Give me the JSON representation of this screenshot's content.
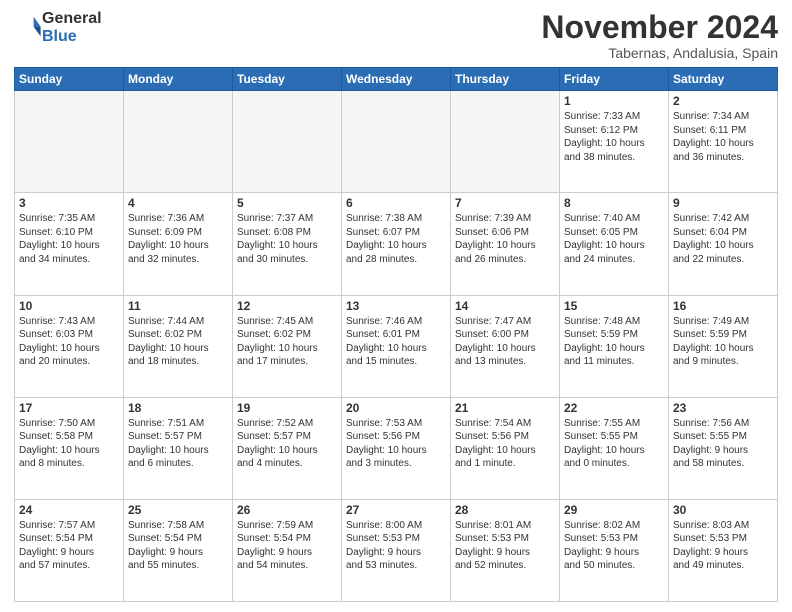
{
  "header": {
    "logo_line1": "General",
    "logo_line2": "Blue",
    "month": "November 2024",
    "location": "Tabernas, Andalusia, Spain"
  },
  "weekdays": [
    "Sunday",
    "Monday",
    "Tuesday",
    "Wednesday",
    "Thursday",
    "Friday",
    "Saturday"
  ],
  "weeks": [
    [
      {
        "day": "",
        "info": "",
        "empty": true
      },
      {
        "day": "",
        "info": "",
        "empty": true
      },
      {
        "day": "",
        "info": "",
        "empty": true
      },
      {
        "day": "",
        "info": "",
        "empty": true
      },
      {
        "day": "",
        "info": "",
        "empty": true
      },
      {
        "day": "1",
        "info": "Sunrise: 7:33 AM\nSunset: 6:12 PM\nDaylight: 10 hours\nand 38 minutes.",
        "empty": false
      },
      {
        "day": "2",
        "info": "Sunrise: 7:34 AM\nSunset: 6:11 PM\nDaylight: 10 hours\nand 36 minutes.",
        "empty": false
      }
    ],
    [
      {
        "day": "3",
        "info": "Sunrise: 7:35 AM\nSunset: 6:10 PM\nDaylight: 10 hours\nand 34 minutes.",
        "empty": false
      },
      {
        "day": "4",
        "info": "Sunrise: 7:36 AM\nSunset: 6:09 PM\nDaylight: 10 hours\nand 32 minutes.",
        "empty": false
      },
      {
        "day": "5",
        "info": "Sunrise: 7:37 AM\nSunset: 6:08 PM\nDaylight: 10 hours\nand 30 minutes.",
        "empty": false
      },
      {
        "day": "6",
        "info": "Sunrise: 7:38 AM\nSunset: 6:07 PM\nDaylight: 10 hours\nand 28 minutes.",
        "empty": false
      },
      {
        "day": "7",
        "info": "Sunrise: 7:39 AM\nSunset: 6:06 PM\nDaylight: 10 hours\nand 26 minutes.",
        "empty": false
      },
      {
        "day": "8",
        "info": "Sunrise: 7:40 AM\nSunset: 6:05 PM\nDaylight: 10 hours\nand 24 minutes.",
        "empty": false
      },
      {
        "day": "9",
        "info": "Sunrise: 7:42 AM\nSunset: 6:04 PM\nDaylight: 10 hours\nand 22 minutes.",
        "empty": false
      }
    ],
    [
      {
        "day": "10",
        "info": "Sunrise: 7:43 AM\nSunset: 6:03 PM\nDaylight: 10 hours\nand 20 minutes.",
        "empty": false
      },
      {
        "day": "11",
        "info": "Sunrise: 7:44 AM\nSunset: 6:02 PM\nDaylight: 10 hours\nand 18 minutes.",
        "empty": false
      },
      {
        "day": "12",
        "info": "Sunrise: 7:45 AM\nSunset: 6:02 PM\nDaylight: 10 hours\nand 17 minutes.",
        "empty": false
      },
      {
        "day": "13",
        "info": "Sunrise: 7:46 AM\nSunset: 6:01 PM\nDaylight: 10 hours\nand 15 minutes.",
        "empty": false
      },
      {
        "day": "14",
        "info": "Sunrise: 7:47 AM\nSunset: 6:00 PM\nDaylight: 10 hours\nand 13 minutes.",
        "empty": false
      },
      {
        "day": "15",
        "info": "Sunrise: 7:48 AM\nSunset: 5:59 PM\nDaylight: 10 hours\nand 11 minutes.",
        "empty": false
      },
      {
        "day": "16",
        "info": "Sunrise: 7:49 AM\nSunset: 5:59 PM\nDaylight: 10 hours\nand 9 minutes.",
        "empty": false
      }
    ],
    [
      {
        "day": "17",
        "info": "Sunrise: 7:50 AM\nSunset: 5:58 PM\nDaylight: 10 hours\nand 8 minutes.",
        "empty": false
      },
      {
        "day": "18",
        "info": "Sunrise: 7:51 AM\nSunset: 5:57 PM\nDaylight: 10 hours\nand 6 minutes.",
        "empty": false
      },
      {
        "day": "19",
        "info": "Sunrise: 7:52 AM\nSunset: 5:57 PM\nDaylight: 10 hours\nand 4 minutes.",
        "empty": false
      },
      {
        "day": "20",
        "info": "Sunrise: 7:53 AM\nSunset: 5:56 PM\nDaylight: 10 hours\nand 3 minutes.",
        "empty": false
      },
      {
        "day": "21",
        "info": "Sunrise: 7:54 AM\nSunset: 5:56 PM\nDaylight: 10 hours\nand 1 minute.",
        "empty": false
      },
      {
        "day": "22",
        "info": "Sunrise: 7:55 AM\nSunset: 5:55 PM\nDaylight: 10 hours\nand 0 minutes.",
        "empty": false
      },
      {
        "day": "23",
        "info": "Sunrise: 7:56 AM\nSunset: 5:55 PM\nDaylight: 9 hours\nand 58 minutes.",
        "empty": false
      }
    ],
    [
      {
        "day": "24",
        "info": "Sunrise: 7:57 AM\nSunset: 5:54 PM\nDaylight: 9 hours\nand 57 minutes.",
        "empty": false
      },
      {
        "day": "25",
        "info": "Sunrise: 7:58 AM\nSunset: 5:54 PM\nDaylight: 9 hours\nand 55 minutes.",
        "empty": false
      },
      {
        "day": "26",
        "info": "Sunrise: 7:59 AM\nSunset: 5:54 PM\nDaylight: 9 hours\nand 54 minutes.",
        "empty": false
      },
      {
        "day": "27",
        "info": "Sunrise: 8:00 AM\nSunset: 5:53 PM\nDaylight: 9 hours\nand 53 minutes.",
        "empty": false
      },
      {
        "day": "28",
        "info": "Sunrise: 8:01 AM\nSunset: 5:53 PM\nDaylight: 9 hours\nand 52 minutes.",
        "empty": false
      },
      {
        "day": "29",
        "info": "Sunrise: 8:02 AM\nSunset: 5:53 PM\nDaylight: 9 hours\nand 50 minutes.",
        "empty": false
      },
      {
        "day": "30",
        "info": "Sunrise: 8:03 AM\nSunset: 5:53 PM\nDaylight: 9 hours\nand 49 minutes.",
        "empty": false
      }
    ]
  ]
}
